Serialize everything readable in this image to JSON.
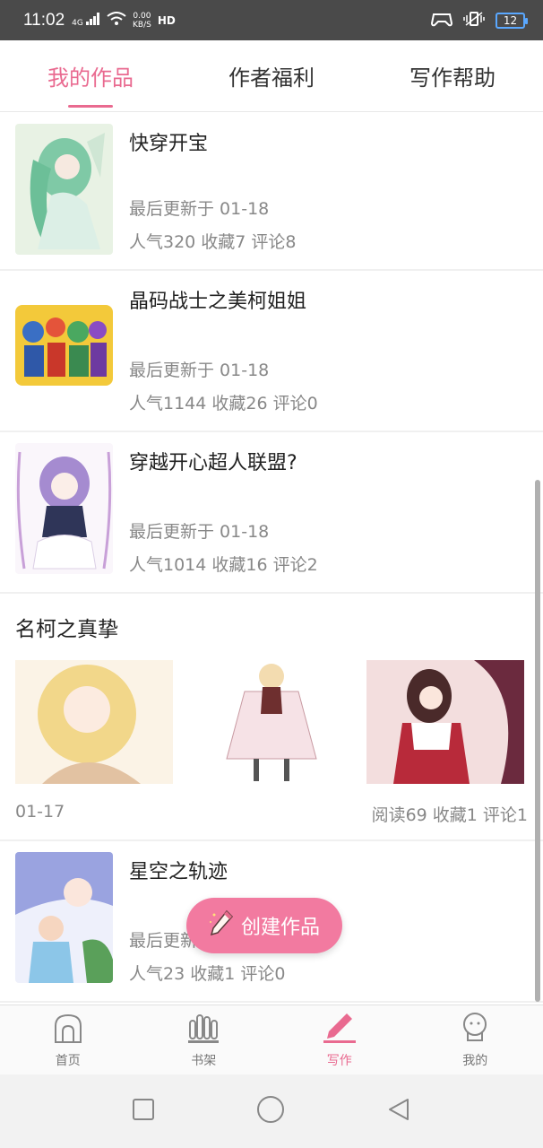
{
  "statusbar": {
    "time": "11:02",
    "network": "4G",
    "speed_value": "0.00",
    "speed_unit": "KB/S",
    "hd": "HD",
    "battery": "12"
  },
  "tabs": [
    {
      "label": "我的作品",
      "active": true
    },
    {
      "label": "作者福利",
      "active": false
    },
    {
      "label": "写作帮助",
      "active": false
    }
  ],
  "works": [
    {
      "title": "快穿开宝",
      "updated": "最后更新于 01-18",
      "stats": "人气320  收藏7  评论8"
    },
    {
      "title": "晶码战士之美柯姐姐",
      "updated": "最后更新于 01-18",
      "stats": "人气1144  收藏26  评论0"
    },
    {
      "title": "穿越开心超人联盟?",
      "updated": "最后更新于 01-18",
      "stats": "人气1014  收藏16  评论2"
    }
  ],
  "gallery_post": {
    "title": "名柯之真挚",
    "date": "01-17",
    "stats": "阅读69  收藏1  评论1"
  },
  "last_work": {
    "title": "星空之轨迹",
    "updated": "最后更新于 01-18",
    "stats": "人气23  收藏1  评论0"
  },
  "fab": {
    "label": "创建作品"
  },
  "bottom_nav": [
    {
      "label": "首页",
      "icon": "home-icon"
    },
    {
      "label": "书架",
      "icon": "bookshelf-icon"
    },
    {
      "label": "写作",
      "icon": "pencil-icon",
      "active": true
    },
    {
      "label": "我的",
      "icon": "profile-icon"
    }
  ],
  "colors": {
    "accent": "#e96a90",
    "fab": "#f27aa0",
    "statusbar": "#4a4a4a"
  }
}
